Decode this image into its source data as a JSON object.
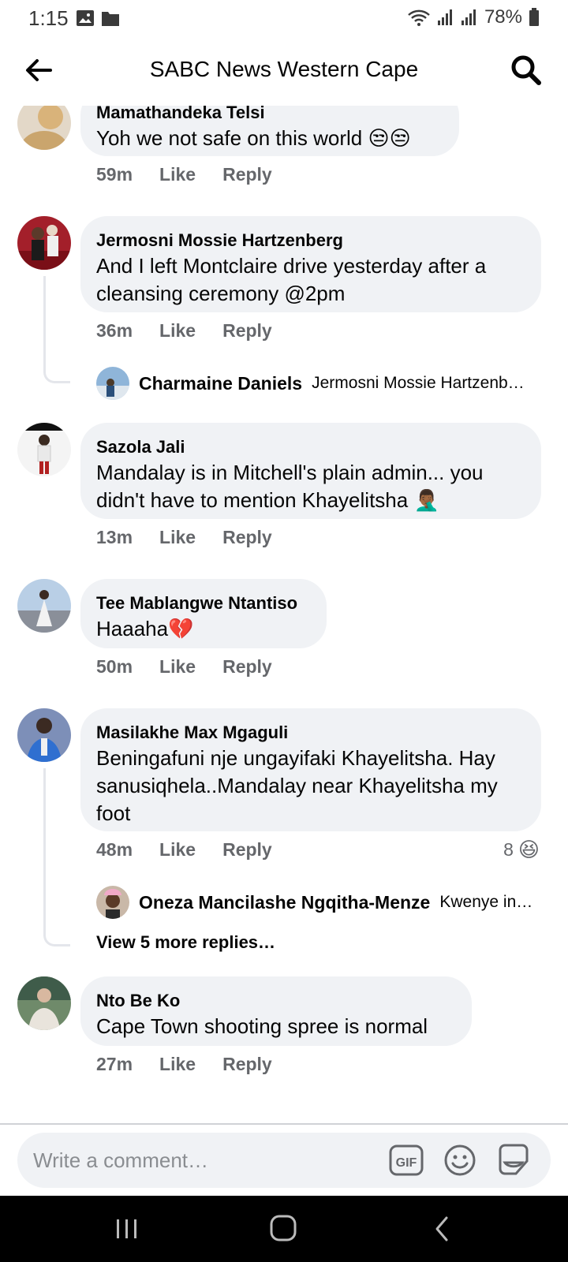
{
  "status_bar": {
    "time": "1:15",
    "battery": "78%"
  },
  "header": {
    "title": "SABC News Western Cape"
  },
  "comments": [
    {
      "name": "Mamathandeka Telsi",
      "text": "Yoh we not safe on this world 😒😒",
      "time": "59m",
      "like": "Like",
      "reply": "Reply"
    },
    {
      "name": "Jermosni Mossie Hartzenberg",
      "text": "And I left Montclaire drive yesterday after a cleansing ceremony @2pm",
      "time": "36m",
      "like": "Like",
      "reply": "Reply",
      "reply_preview": {
        "name": "Charmaine Daniels",
        "text": "Jermosni Mossie Hartzenb…"
      }
    },
    {
      "name": "Sazola Jali",
      "text": "Mandalay is in Mitchell's plain admin... you didn't have to mention Khayelitsha 🤦🏾‍♂️",
      "time": "13m",
      "like": "Like",
      "reply": "Reply"
    },
    {
      "name": "Tee Mablangwe Ntantiso",
      "text": "Haaaha💔",
      "time": "50m",
      "like": "Like",
      "reply": "Reply"
    },
    {
      "name": "Masilakhe Max Mgaguli",
      "text": "Beningafuni nje ungayifaki Khayelitsha. Hay sanusiqhela..Mandalay near Khayelitsha my foot",
      "time": "48m",
      "like": "Like",
      "reply": "Reply",
      "reaction_count": "8",
      "reaction_emoji": "😆",
      "reply_preview": {
        "name": "Oneza Mancilashe Ngqitha-Menze",
        "text": "Kwenye in…"
      },
      "more_replies": "View 5 more replies…"
    },
    {
      "name": "Nto Be Ko",
      "text": "Cape Town shooting spree is normal",
      "time": "27m",
      "like": "Like",
      "reply": "Reply"
    }
  ],
  "composer": {
    "placeholder": "Write a comment…",
    "gif_label": "GIF"
  },
  "icons": [
    "back-arrow-icon",
    "search-icon",
    "gif-icon",
    "emoji-icon",
    "sticker-icon",
    "recents-icon",
    "home-icon",
    "nav-back-icon"
  ]
}
